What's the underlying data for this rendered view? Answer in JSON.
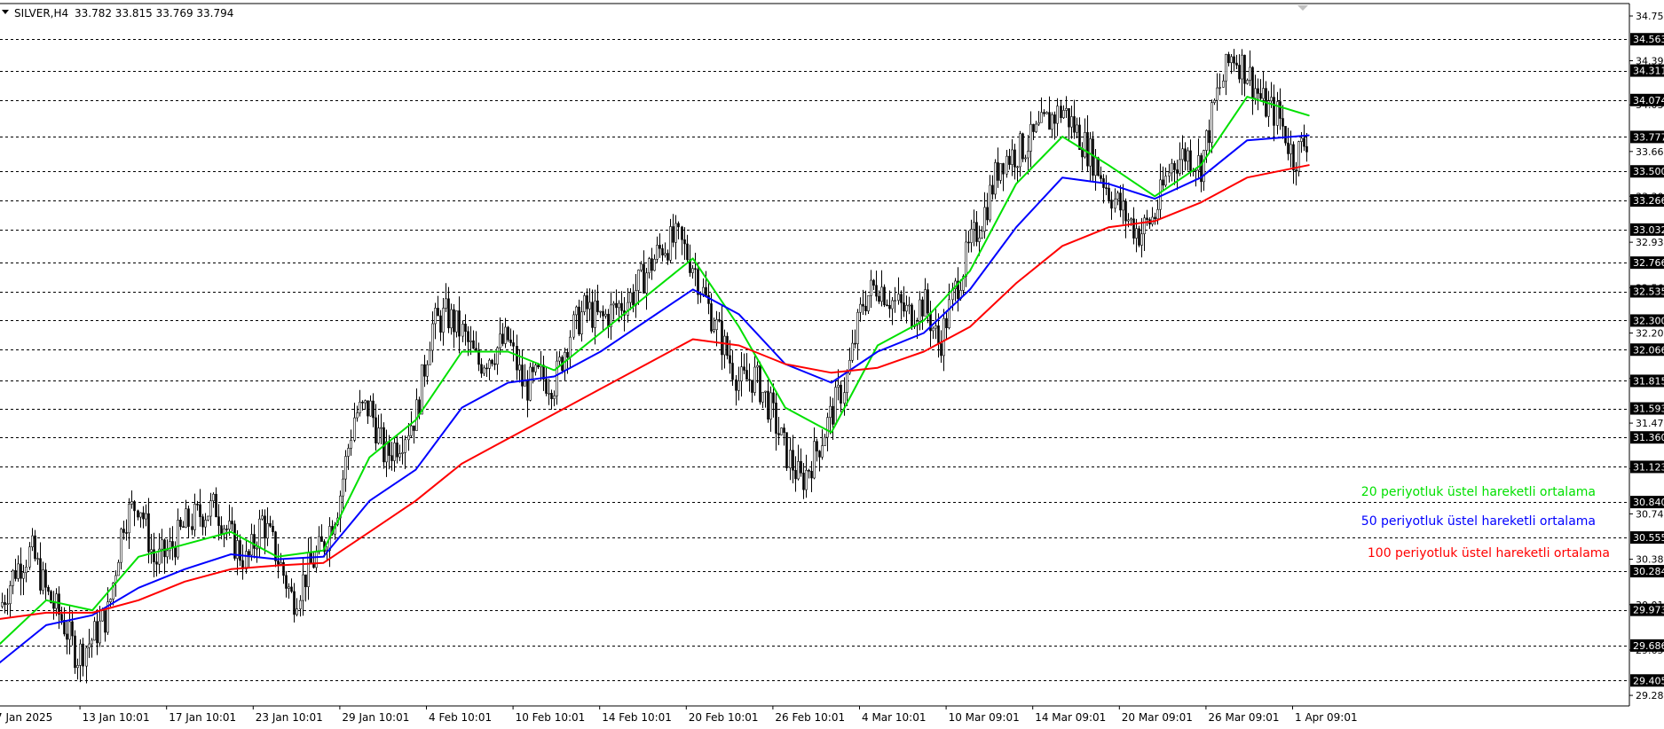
{
  "header": {
    "symbol_text": "SILVER,H4",
    "ohlc_text": "33.782 33.815 33.769 33.794"
  },
  "legend": [
    {
      "label": "20 periyotluk üstel hareketli ortalama",
      "color": "#00e000"
    },
    {
      "label": "50 periyotluk üstel hareketli ortalama",
      "color": "#0000ff"
    },
    {
      "label": "100 periyotluk üstel hareketli ortalama",
      "color": "#ff0000"
    }
  ],
  "colors": {
    "background": "#ffffff",
    "candles": "#000000",
    "gridline": "#000000",
    "ema20": "#00e000",
    "ema50": "#0000ff",
    "ema100": "#ff0000",
    "price_box": "#000000",
    "price_box_text": "#ffffff"
  },
  "chart_data": {
    "type": "candlestick",
    "ylim": [
      29.2,
      34.85
    ],
    "xlim": [
      "2025-01-07",
      "2025-04-03"
    ],
    "x_tick_labels": [
      "7 Jan 2025",
      "13 Jan 10:01",
      "17 Jan 10:01",
      "23 Jan 10:01",
      "29 Jan 10:01",
      "4 Feb 10:01",
      "10 Feb 10:01",
      "14 Feb 10:01",
      "20 Feb 10:01",
      "26 Feb 10:01",
      "4 Mar 10:01",
      "10 Mar 09:01",
      "14 Mar 09:01",
      "20 Mar 09:01",
      "26 Mar 09:01",
      "1 Apr 09:01"
    ],
    "y_tick_labels": [
      "34.750",
      "34.390",
      "34.035",
      "33.660",
      "33.300",
      "32.930",
      "32.565",
      "32.200",
      "31.835",
      "31.475",
      "31.110",
      "30.745",
      "30.380",
      "30.015",
      "29.650",
      "29.285"
    ],
    "level_lines": [
      {
        "label": "34.563",
        "value": 34.563
      },
      {
        "label": "34.311",
        "value": 34.311
      },
      {
        "label": "34.074",
        "value": 34.074
      },
      {
        "label": "33.777",
        "value": 33.777
      },
      {
        "label": "33.500",
        "value": 33.5
      },
      {
        "label": "33.266",
        "value": 33.266
      },
      {
        "label": "33.032",
        "value": 33.032
      },
      {
        "label": "32.766",
        "value": 32.766
      },
      {
        "label": "32.535",
        "value": 32.535
      },
      {
        "label": "32.300",
        "value": 32.3
      },
      {
        "label": "32.066",
        "value": 32.066
      },
      {
        "label": "31.815",
        "value": 31.815
      },
      {
        "label": "31.593",
        "value": 31.593
      },
      {
        "label": "31.360",
        "value": 31.36
      },
      {
        "label": "31.123",
        "value": 31.123
      },
      {
        "label": "30.840",
        "value": 30.84
      },
      {
        "label": "30.555",
        "value": 30.555
      },
      {
        "label": "30.284",
        "value": 30.284
      },
      {
        "label": "29.973",
        "value": 29.973
      },
      {
        "label": "29.686",
        "value": 29.686
      },
      {
        "label": "29.405",
        "value": 29.405
      }
    ],
    "price_path": [
      [
        "2025-01-07",
        30.0
      ],
      [
        "2025-01-08",
        30.3
      ],
      [
        "2025-01-09",
        30.45
      ],
      [
        "2025-01-10",
        30.1
      ],
      [
        "2025-01-11",
        29.9
      ],
      [
        "2025-01-12",
        29.6
      ],
      [
        "2025-01-13",
        29.75
      ],
      [
        "2025-01-14",
        29.95
      ],
      [
        "2025-01-15",
        30.7
      ],
      [
        "2025-01-16",
        30.85
      ],
      [
        "2025-01-17",
        30.35
      ],
      [
        "2025-01-18",
        30.45
      ],
      [
        "2025-01-19",
        30.65
      ],
      [
        "2025-01-20",
        30.75
      ],
      [
        "2025-01-21",
        30.8
      ],
      [
        "2025-01-22",
        30.55
      ],
      [
        "2025-01-23",
        30.35
      ],
      [
        "2025-01-24",
        30.7
      ],
      [
        "2025-01-25",
        30.4
      ],
      [
        "2025-01-26",
        30.05
      ],
      [
        "2025-01-27",
        30.3
      ],
      [
        "2025-01-28",
        30.5
      ],
      [
        "2025-01-29",
        30.85
      ],
      [
        "2025-01-30",
        31.55
      ],
      [
        "2025-01-31",
        31.6
      ],
      [
        "2025-02-01",
        31.2
      ],
      [
        "2025-02-02",
        31.35
      ],
      [
        "2025-02-03",
        31.55
      ],
      [
        "2025-02-04",
        32.25
      ],
      [
        "2025-02-05",
        32.35
      ],
      [
        "2025-02-06",
        32.2
      ],
      [
        "2025-02-07",
        31.95
      ],
      [
        "2025-02-08",
        32.05
      ],
      [
        "2025-02-09",
        32.15
      ],
      [
        "2025-02-10",
        31.75
      ],
      [
        "2025-02-11",
        31.85
      ],
      [
        "2025-02-12",
        31.8
      ],
      [
        "2025-02-13",
        32.2
      ],
      [
        "2025-02-14",
        32.4
      ],
      [
        "2025-02-15",
        32.3
      ],
      [
        "2025-02-16",
        32.4
      ],
      [
        "2025-02-17",
        32.5
      ],
      [
        "2025-02-18",
        32.7
      ],
      [
        "2025-02-19",
        32.9
      ],
      [
        "2025-02-20",
        32.95
      ],
      [
        "2025-02-21",
        32.75
      ],
      [
        "2025-02-22",
        32.4
      ],
      [
        "2025-02-23",
        32.1
      ],
      [
        "2025-02-24",
        31.8
      ],
      [
        "2025-02-25",
        31.85
      ],
      [
        "2025-02-26",
        31.6
      ],
      [
        "2025-02-27",
        31.25
      ],
      [
        "2025-02-28",
        31.0
      ],
      [
        "2025-03-01",
        31.25
      ],
      [
        "2025-03-02",
        31.55
      ],
      [
        "2025-03-03",
        31.85
      ],
      [
        "2025-03-04",
        32.45
      ],
      [
        "2025-03-05",
        32.6
      ],
      [
        "2025-03-06",
        32.45
      ],
      [
        "2025-03-07",
        32.35
      ],
      [
        "2025-03-08",
        32.45
      ],
      [
        "2025-03-09",
        32.1
      ],
      [
        "2025-03-10",
        32.55
      ],
      [
        "2025-03-11",
        32.9
      ],
      [
        "2025-03-12",
        33.2
      ],
      [
        "2025-03-13",
        33.6
      ],
      [
        "2025-03-14",
        33.65
      ],
      [
        "2025-03-15",
        33.75
      ],
      [
        "2025-03-16",
        33.9
      ],
      [
        "2025-03-17",
        34.0
      ],
      [
        "2025-03-18",
        33.8
      ],
      [
        "2025-03-19",
        33.6
      ],
      [
        "2025-03-20",
        33.35
      ],
      [
        "2025-03-21",
        33.15
      ],
      [
        "2025-03-22",
        33.0
      ],
      [
        "2025-03-23",
        33.15
      ],
      [
        "2025-03-24",
        33.55
      ],
      [
        "2025-03-25",
        33.65
      ],
      [
        "2025-03-26",
        33.55
      ],
      [
        "2025-03-27",
        34.1
      ],
      [
        "2025-03-28",
        34.45
      ],
      [
        "2025-03-29",
        34.3
      ],
      [
        "2025-03-30",
        34.05
      ],
      [
        "2025-03-31",
        33.95
      ],
      [
        "2025-04-01",
        33.6
      ],
      [
        "2025-04-02",
        33.79
      ]
    ],
    "series": [
      {
        "name": "20 periyotluk üstel hareketli ortalama",
        "color": "#00e000",
        "points": [
          [
            "2025-01-07",
            29.7
          ],
          [
            "2025-01-10",
            30.05
          ],
          [
            "2025-01-13",
            29.97
          ],
          [
            "2025-01-16",
            30.4
          ],
          [
            "2025-01-19",
            30.5
          ],
          [
            "2025-01-22",
            30.6
          ],
          [
            "2025-01-25",
            30.4
          ],
          [
            "2025-01-28",
            30.45
          ],
          [
            "2025-01-31",
            31.2
          ],
          [
            "2025-02-03",
            31.5
          ],
          [
            "2025-02-06",
            32.05
          ],
          [
            "2025-02-09",
            32.05
          ],
          [
            "2025-02-12",
            31.9
          ],
          [
            "2025-02-15",
            32.2
          ],
          [
            "2025-02-18",
            32.5
          ],
          [
            "2025-02-21",
            32.8
          ],
          [
            "2025-02-24",
            32.25
          ],
          [
            "2025-02-27",
            31.6
          ],
          [
            "2025-03-02",
            31.4
          ],
          [
            "2025-03-05",
            32.1
          ],
          [
            "2025-03-08",
            32.3
          ],
          [
            "2025-03-11",
            32.7
          ],
          [
            "2025-03-14",
            33.4
          ],
          [
            "2025-03-17",
            33.78
          ],
          [
            "2025-03-20",
            33.55
          ],
          [
            "2025-03-23",
            33.3
          ],
          [
            "2025-03-26",
            33.55
          ],
          [
            "2025-03-29",
            34.1
          ],
          [
            "2025-04-02",
            33.95
          ]
        ]
      },
      {
        "name": "50 periyotluk üstel hareketli ortalama",
        "color": "#0000ff",
        "points": [
          [
            "2025-01-07",
            29.55
          ],
          [
            "2025-01-10",
            29.85
          ],
          [
            "2025-01-13",
            29.93
          ],
          [
            "2025-01-16",
            30.15
          ],
          [
            "2025-01-19",
            30.3
          ],
          [
            "2025-01-22",
            30.42
          ],
          [
            "2025-01-25",
            30.38
          ],
          [
            "2025-01-28",
            30.4
          ],
          [
            "2025-01-31",
            30.85
          ],
          [
            "2025-02-03",
            31.1
          ],
          [
            "2025-02-06",
            31.6
          ],
          [
            "2025-02-09",
            31.8
          ],
          [
            "2025-02-12",
            31.85
          ],
          [
            "2025-02-15",
            32.05
          ],
          [
            "2025-02-18",
            32.3
          ],
          [
            "2025-02-21",
            32.55
          ],
          [
            "2025-02-24",
            32.35
          ],
          [
            "2025-02-27",
            31.95
          ],
          [
            "2025-03-02",
            31.8
          ],
          [
            "2025-03-05",
            32.05
          ],
          [
            "2025-03-08",
            32.2
          ],
          [
            "2025-03-11",
            32.55
          ],
          [
            "2025-03-14",
            33.05
          ],
          [
            "2025-03-17",
            33.45
          ],
          [
            "2025-03-20",
            33.4
          ],
          [
            "2025-03-23",
            33.28
          ],
          [
            "2025-03-26",
            33.45
          ],
          [
            "2025-03-29",
            33.75
          ],
          [
            "2025-04-02",
            33.79
          ]
        ]
      },
      {
        "name": "100 periyotluk üstel hareketli ortalama",
        "color": "#ff0000",
        "points": [
          [
            "2025-01-07",
            29.9
          ],
          [
            "2025-01-10",
            29.95
          ],
          [
            "2025-01-13",
            29.95
          ],
          [
            "2025-01-16",
            30.05
          ],
          [
            "2025-01-19",
            30.2
          ],
          [
            "2025-01-22",
            30.3
          ],
          [
            "2025-01-25",
            30.33
          ],
          [
            "2025-01-28",
            30.35
          ],
          [
            "2025-01-31",
            30.6
          ],
          [
            "2025-02-03",
            30.85
          ],
          [
            "2025-02-06",
            31.15
          ],
          [
            "2025-02-09",
            31.35
          ],
          [
            "2025-02-12",
            31.55
          ],
          [
            "2025-02-15",
            31.75
          ],
          [
            "2025-02-18",
            31.95
          ],
          [
            "2025-02-21",
            32.15
          ],
          [
            "2025-02-24",
            32.1
          ],
          [
            "2025-02-27",
            31.95
          ],
          [
            "2025-03-02",
            31.88
          ],
          [
            "2025-03-05",
            31.92
          ],
          [
            "2025-03-08",
            32.05
          ],
          [
            "2025-03-11",
            32.25
          ],
          [
            "2025-03-14",
            32.6
          ],
          [
            "2025-03-17",
            32.9
          ],
          [
            "2025-03-20",
            33.05
          ],
          [
            "2025-03-23",
            33.1
          ],
          [
            "2025-03-26",
            33.25
          ],
          [
            "2025-03-29",
            33.45
          ],
          [
            "2025-04-02",
            33.55
          ]
        ]
      }
    ]
  }
}
